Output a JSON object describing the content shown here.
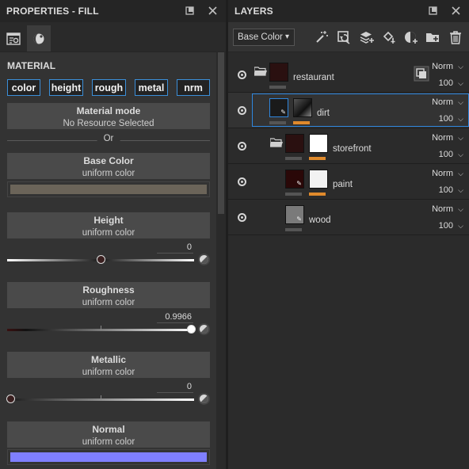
{
  "properties": {
    "title": "PROPERTIES - FILL",
    "section": "MATERIAL",
    "channels": [
      "color",
      "height",
      "rough",
      "metal",
      "nrm"
    ],
    "material_mode": {
      "title": "Material mode",
      "subtitle": "No Resource Selected"
    },
    "or_label": "Or",
    "base_color": {
      "title": "Base Color",
      "subtitle": "uniform color",
      "swatch": "#6b6459"
    },
    "height": {
      "title": "Height",
      "subtitle": "uniform color",
      "value": "0"
    },
    "roughness": {
      "title": "Roughness",
      "subtitle": "uniform color",
      "value": "0.9966"
    },
    "metallic": {
      "title": "Metallic",
      "subtitle": "uniform color",
      "value": "0"
    },
    "normal": {
      "title": "Normal",
      "subtitle": "uniform color",
      "swatch": "#7f7fff"
    },
    "icons": [
      "settings-tab-icon",
      "shader-tab-icon",
      "undock-icon",
      "close-icon"
    ]
  },
  "layers": {
    "title": "LAYERS",
    "channel_dropdown": "Base Color",
    "toolbar_icons": [
      "magic-wand-icon",
      "refresh-icon",
      "add-layer-icon",
      "fill-layer-icon",
      "mask-icon",
      "add-folder-icon",
      "trash-icon"
    ],
    "items": [
      {
        "name": "restaurant",
        "blend": "Norm",
        "opacity": "100",
        "type": "folder"
      },
      {
        "name": "dirt",
        "blend": "Norm",
        "opacity": "100",
        "type": "fill",
        "selected": true
      },
      {
        "name": "storefront",
        "blend": "Norm",
        "opacity": "100",
        "type": "folder"
      },
      {
        "name": "paint",
        "blend": "Norm",
        "opacity": "100",
        "type": "fill"
      },
      {
        "name": "wood",
        "blend": "Norm",
        "opacity": "100",
        "type": "fill"
      }
    ],
    "colors": {
      "accent": "#2e86de",
      "mask_bar": "#e08a2c"
    }
  }
}
